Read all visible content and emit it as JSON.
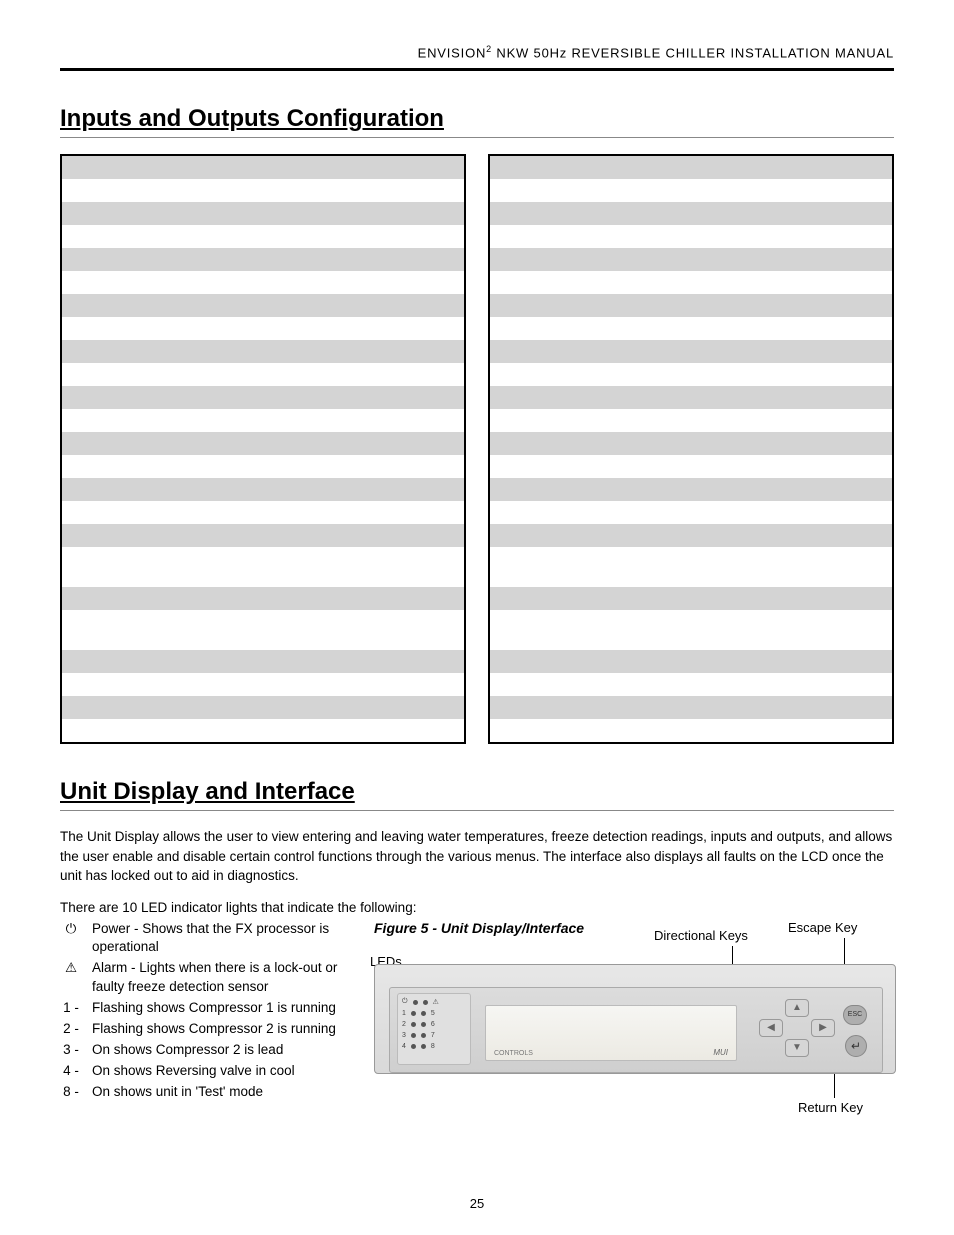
{
  "header": {
    "product_prefix": "ENVISION",
    "superscript": "2",
    "product_suffix": " NKW 50Hz REVERSIBLE CHILLER INSTALLATION MANUAL"
  },
  "section1": {
    "title": "Inputs and Outputs Configuration"
  },
  "section2": {
    "title": "Unit Display and Interface",
    "paragraph1": "The Unit Display allows the user to view entering and leaving water temperatures, freeze detection readings, inputs and outputs, and allows the user enable and disable certain control functions through the various menus. The interface also displays all faults on the LCD once the unit has locked out to aid in diagnostics.",
    "paragraph2": "There are 10 LED indicator lights that indicate the following:"
  },
  "led_items": [
    {
      "key": "⏻",
      "text": "Power - Shows that the FX processor is operational"
    },
    {
      "key": "⚠",
      "text": "Alarm - Lights when there is a lock-out or faulty freeze detection sensor"
    },
    {
      "key": "1 -",
      "text": "Flashing shows Compressor 1 is running"
    },
    {
      "key": "2 -",
      "text": "Flashing shows Compressor 2 is running"
    },
    {
      "key": "3 -",
      "text": "On shows Compressor 2 is lead"
    },
    {
      "key": "4 -",
      "text": "On shows Reversing valve in cool"
    },
    {
      "key": "8 -",
      "text": "On shows unit in 'Test' mode"
    }
  ],
  "figure": {
    "caption": "Figure 5 - Unit Display/Interface",
    "labels": {
      "leds": "LEDs",
      "directional": "Directional Keys",
      "escape": "Escape Key",
      "return": "Return Key"
    },
    "device": {
      "esc_label": "ESC",
      "return_glyph": "↵",
      "lcd_brand_left": "CONTROLS",
      "lcd_brand_right": "MUI",
      "led_rows": [
        [
          "⏻",
          "",
          "",
          "⚠"
        ],
        [
          "1",
          "",
          "",
          "5"
        ],
        [
          "2",
          "",
          "",
          "6"
        ],
        [
          "3",
          "",
          "",
          "7"
        ],
        [
          "4",
          "",
          "",
          "8"
        ]
      ]
    }
  },
  "page_number": "25"
}
